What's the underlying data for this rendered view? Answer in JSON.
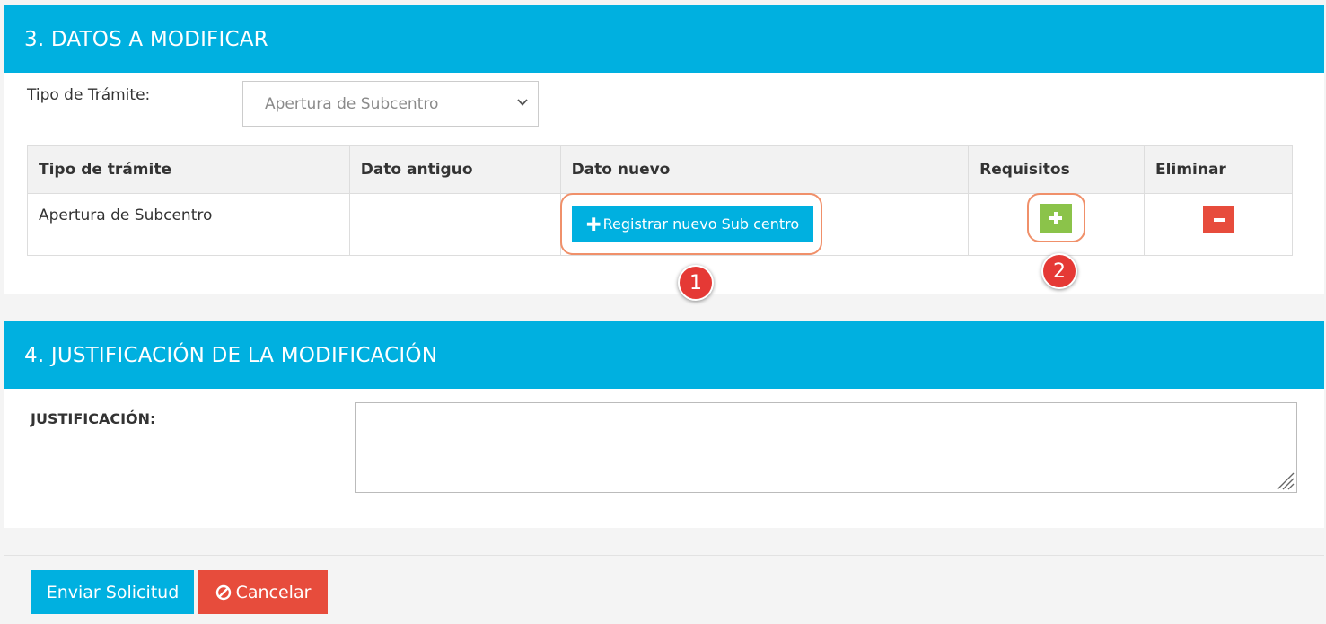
{
  "section3": {
    "title": "3. DATOS A MODIFICAR",
    "tramite_label": "Tipo de Trámite:",
    "tramite_selected": "Apertura de Subcentro",
    "table": {
      "headers": [
        "Tipo de trámite",
        "Dato antiguo",
        "Dato nuevo",
        "Requisitos",
        "Eliminar"
      ],
      "rows": [
        {
          "tipo": "Apertura de Subcentro",
          "antiguo": ""
        }
      ]
    },
    "register_button_label": "Registrar nuevo Sub centro",
    "add_icon": "plus-icon",
    "delete_icon": "minus-icon"
  },
  "annotations": {
    "marker1": "1",
    "marker2": "2",
    "highlight_color": "#f0906a",
    "marker_color": "#e53935"
  },
  "section4": {
    "title": "4. JUSTIFICACIÓN DE LA MODIFICACIÓN",
    "justification_label": "JUSTIFICACIÓN:",
    "justification_value": ""
  },
  "footer": {
    "submit_label": "Enviar Solicitud",
    "cancel_label": "Cancelar",
    "cancel_icon": "ban-icon"
  },
  "colors": {
    "header": "#00b0e0",
    "primary_button": "#00b0e0",
    "success_button": "#8bc34a",
    "danger_button": "#e74c3c"
  }
}
